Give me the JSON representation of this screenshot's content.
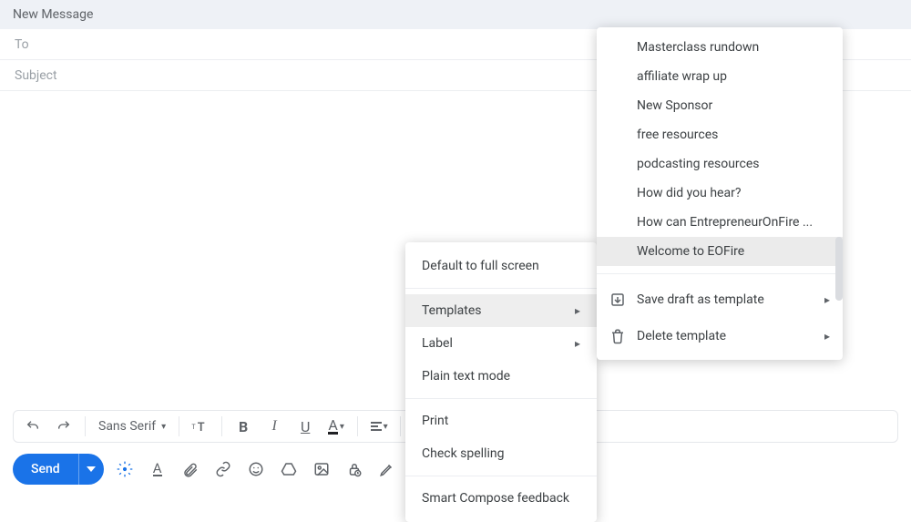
{
  "header": {
    "title": "New Message"
  },
  "fields": {
    "to_placeholder": "To",
    "subject_placeholder": "Subject"
  },
  "format_toolbar": {
    "font": "Sans Serif",
    "bold": "B",
    "italic": "I",
    "underline": "U",
    "text_color": "A"
  },
  "send": {
    "label": "Send"
  },
  "more_menu": {
    "default_full_screen": "Default to full screen",
    "templates": "Templates",
    "label": "Label",
    "plain_text": "Plain text mode",
    "print": "Print",
    "check_spelling": "Check spelling",
    "smart_compose": "Smart Compose feedback"
  },
  "templates_menu": {
    "items": [
      "Masterclass rundown",
      "affiliate wrap up",
      "New Sponsor",
      "free resources",
      "podcasting resources",
      "How did you hear?",
      "How can EntrepreneurOnFire ...",
      "Welcome to EOFire"
    ],
    "selected_index": 7,
    "save_draft": "Save draft as template",
    "delete_template": "Delete template"
  }
}
